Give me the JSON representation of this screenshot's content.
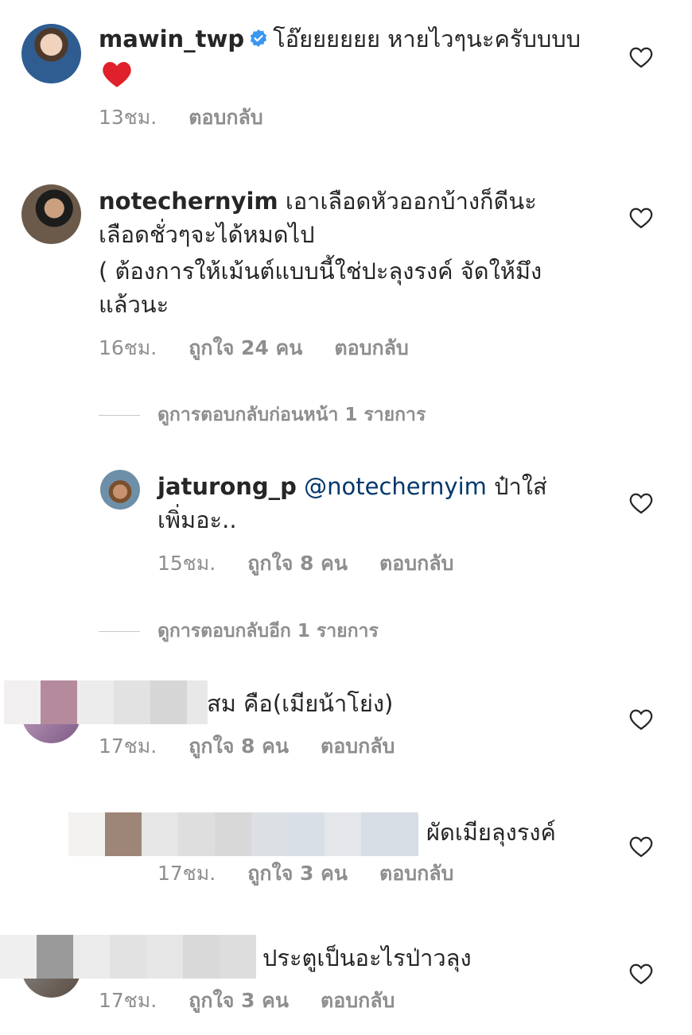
{
  "comments": [
    {
      "username": "mawin_twp",
      "verified": true,
      "text": "โอ๊ยยยยยย หายไวๆนะครับบบบ",
      "emoji": "heart",
      "time": "13ชม.",
      "reply": "ตอบกลับ"
    },
    {
      "username": "notechernyim",
      "text_line1": "เอาเลือดหัวออกบ้างก็ดีนะ",
      "text_line2": "เลือดชั่วๆจะได้หมดไป",
      "text_line3": "( ต้องการให้เม้นต์แบบนี้ใช่ปะลุงรงค์ จัดให้มึง",
      "text_line4": "แล้วนะ",
      "time": "16ชม.",
      "likes": "ถูกใจ 24 คน",
      "reply": "ตอบกลับ",
      "view_previous": "ดูการตอบกลับก่อนหน้า 1 รายการ"
    },
    {
      "username": "jaturong_p",
      "mention": "@notechernyim",
      "text_a": "ป๋าใส่",
      "text_b": "เพิ่มอะ..",
      "time": "15ชม.",
      "likes": "ถูกใจ 8 คน",
      "reply": "ตอบกลับ",
      "view_more": "ดูการตอบกลับอีก 1 รายการ"
    },
    {
      "text": "สม คือ(เมียน้าโย่ง)",
      "time": "17ชม.",
      "likes": "ถูกใจ 8 คน",
      "reply": "ตอบกลับ"
    },
    {
      "text": "ผัดเมียลุงรงค์",
      "time": "17ชม.",
      "likes": "ถูกใจ 3 คน",
      "reply": "ตอบกลับ"
    },
    {
      "text": "ประตูเป็นอะไรป่าวลุง",
      "time": "17ชม.",
      "likes": "ถูกใจ 3 คน",
      "reply": "ตอบกลับ"
    }
  ],
  "colors": {
    "text": "#262626",
    "secondary": "#8e8e8e",
    "mention": "#00376b",
    "verified": "#3897f0",
    "heart": "#e0202a"
  }
}
